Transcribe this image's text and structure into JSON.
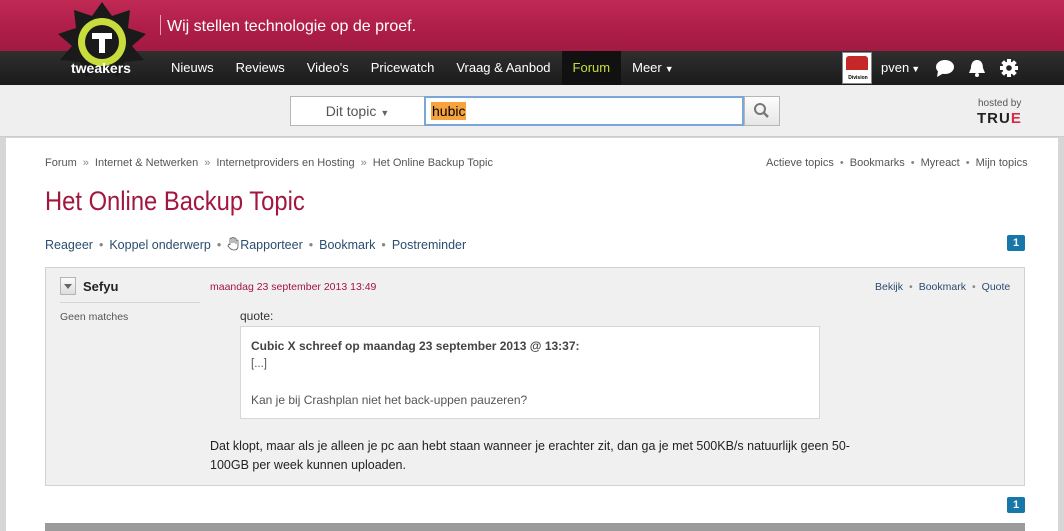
{
  "header": {
    "tagline": "Wij stellen technologie op de proef.",
    "logo_text": "tweakers"
  },
  "nav": {
    "items": [
      {
        "label": "Nieuws"
      },
      {
        "label": "Reviews"
      },
      {
        "label": "Video's"
      },
      {
        "label": "Pricewatch"
      },
      {
        "label": "Vraag & Aanbod"
      },
      {
        "label": "Forum",
        "active": true
      },
      {
        "label": "Meer",
        "dropdown": true
      }
    ],
    "user": {
      "name": "pven",
      "avatar_text": "Division Brabant"
    },
    "icons": [
      "chat-icon",
      "bell-icon",
      "gear-icon"
    ],
    "active_color": "#c8dc3c"
  },
  "search": {
    "scope": "Dit topic",
    "value": "hubic",
    "hosted_by": "hosted by",
    "host_logo": "TRU",
    "host_logo_accent": "E"
  },
  "breadcrumb": [
    "Forum",
    "Internet & Netwerken",
    "Internetproviders en Hosting",
    "Het Online Backup Topic"
  ],
  "top_links": [
    "Actieve topics",
    "Bookmarks",
    "Myreact",
    "Mijn topics"
  ],
  "topic": {
    "title": "Het Online Backup Topic",
    "actions": [
      "Reageer",
      "Koppel onderwerp",
      "Rapporteer",
      "Bookmark",
      "Postreminder"
    ],
    "page": "1"
  },
  "post": {
    "author": "Sefyu",
    "author_meta": "Geen matches",
    "date": "maandag 23 september 2013 13:49",
    "links": [
      "Bekijk",
      "Bookmark",
      "Quote"
    ],
    "quote_label": "quote:",
    "quote_author": "Cubic X schreef op maandag 23 september 2013 @ 13:37:",
    "quote_ellipsis": "[...]",
    "quote_text": "Kan je bij Crashplan niet het back-uppen pauzeren?",
    "body": "Dat klopt, maar als je alleen je pc aan hebt staan wanneer je erachter zit, dan ga je met 500KB/s natuurlijk geen 50-100GB per week kunnen uploaden."
  },
  "colors": {
    "brand": "#ad1d47",
    "title": "#a3163e",
    "link": "#2b4c6f",
    "badge": "#1677a8"
  }
}
